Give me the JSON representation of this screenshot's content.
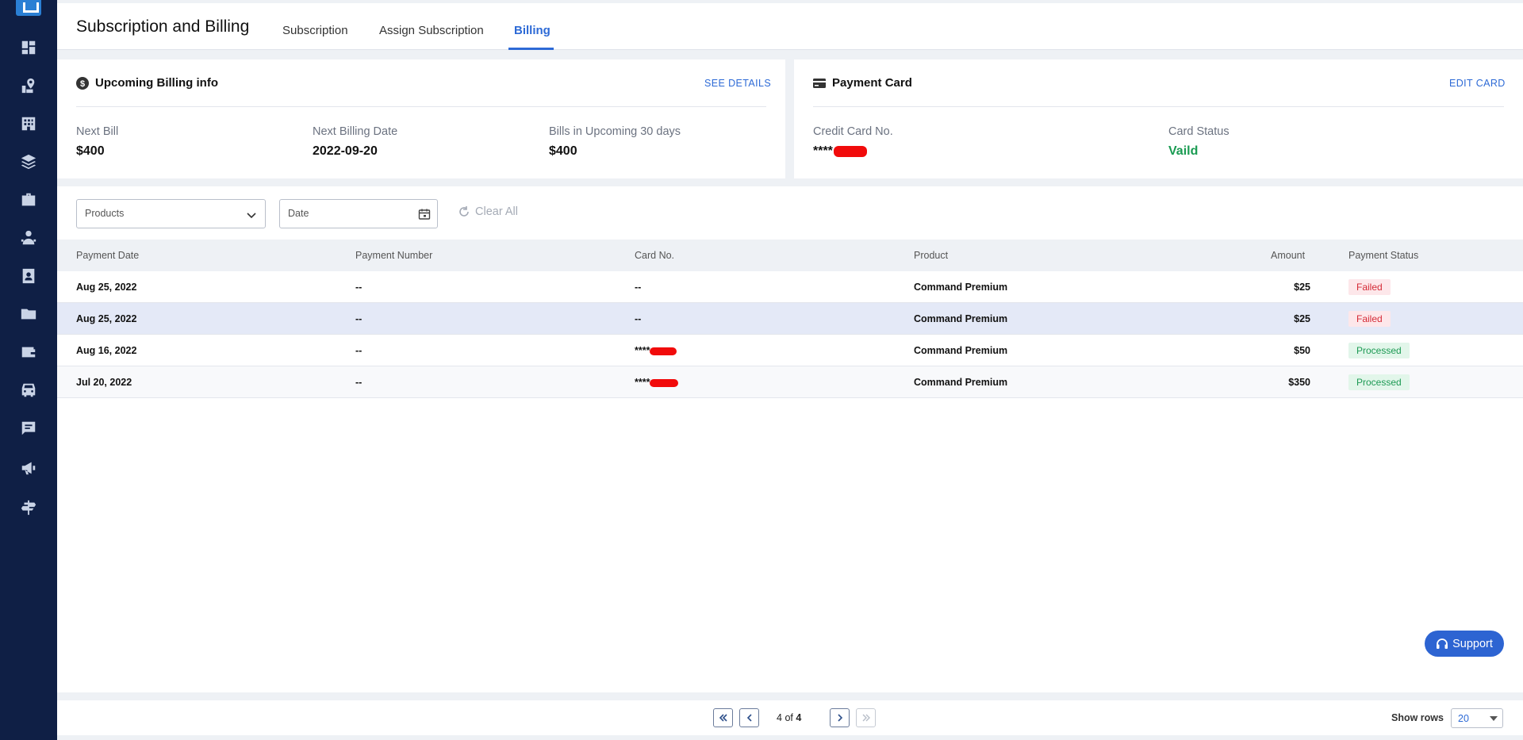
{
  "sidebar": {
    "icons": [
      "dashboard-icon",
      "map-marker-icon",
      "building-icon",
      "layers-icon",
      "briefcase-icon",
      "users-icon",
      "contact-card-icon",
      "folder-icon",
      "wallet-icon",
      "vehicle-icon",
      "message-icon",
      "megaphone-icon",
      "signpost-icon"
    ]
  },
  "header": {
    "title": "Subscription and Billing",
    "tabs": [
      "Subscription",
      "Assign Subscription",
      "Billing"
    ],
    "active_tab": "Billing"
  },
  "billing_card": {
    "title": "Upcoming Billing info",
    "link": "SEE DETAILS",
    "next_bill_label": "Next Bill",
    "next_bill_value": "$400",
    "next_date_label": "Next Billing Date",
    "next_date_value": "2022-09-20",
    "upcoming_label": "Bills in Upcoming 30 days",
    "upcoming_value": "$400"
  },
  "payment_card": {
    "title": "Payment Card",
    "link": "EDIT CARD",
    "card_no_label": "Credit Card No.",
    "card_no_value": "****",
    "status_label": "Card Status",
    "status_value": "Vaild"
  },
  "filters": {
    "products_placeholder": "Products",
    "date_placeholder": "Date",
    "clear_all": "Clear All"
  },
  "table": {
    "headers": [
      "Payment Date",
      "Payment Number",
      "Card No.",
      "Product",
      "Amount",
      "Payment Status"
    ],
    "rows": [
      {
        "date": "Aug 25, 2022",
        "number": "--",
        "card": "--",
        "product": "Command Premium",
        "amount": "$25",
        "status": "Failed"
      },
      {
        "date": "Aug 25, 2022",
        "number": "--",
        "card": "--",
        "product": "Command Premium",
        "amount": "$25",
        "status": "Failed"
      },
      {
        "date": "Aug 16, 2022",
        "number": "--",
        "card": "****",
        "product": "Command Premium",
        "amount": "$50",
        "status": "Processed"
      },
      {
        "date": "Jul 20, 2022",
        "number": "--",
        "card": "****",
        "product": "Command Premium",
        "amount": "$350",
        "status": "Processed"
      }
    ]
  },
  "support_label": "Support",
  "pagination": {
    "current": "4",
    "of": "of",
    "total": "4",
    "show_rows_label": "Show rows",
    "rows_value": "20"
  },
  "colors": {
    "sidebar": "#0f1f45",
    "accent": "#2d6ad6",
    "valid_green": "#1a9b52",
    "failed_red": "#d42a36",
    "redaction": "#f10b0b"
  }
}
